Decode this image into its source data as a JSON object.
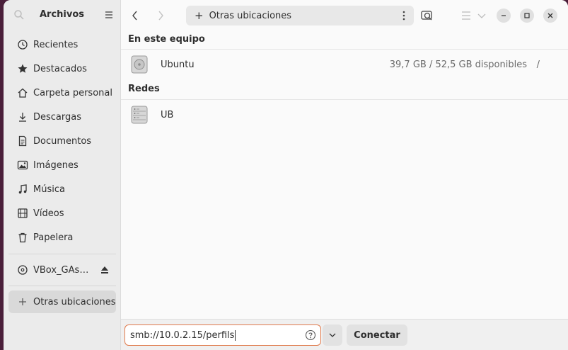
{
  "sidebar": {
    "title": "Archivos",
    "items": [
      {
        "label": "Recientes",
        "icon": "clock-icon"
      },
      {
        "label": "Destacados",
        "icon": "star-icon"
      },
      {
        "label": "Carpeta personal",
        "icon": "home-icon"
      },
      {
        "label": "Descargas",
        "icon": "download-icon"
      },
      {
        "label": "Documentos",
        "icon": "document-icon"
      },
      {
        "label": "Imágenes",
        "icon": "image-icon"
      },
      {
        "label": "Música",
        "icon": "music-icon"
      },
      {
        "label": "Vídeos",
        "icon": "video-icon"
      },
      {
        "label": "Papelera",
        "icon": "trash-icon"
      }
    ],
    "devices": [
      {
        "label": "VBox_GAs_...",
        "icon": "disc-icon"
      }
    ],
    "other_locations": {
      "label": "Otras ubicaciones",
      "icon": "plus-icon"
    }
  },
  "header": {
    "path": "Otras ubicaciones"
  },
  "sections": {
    "this_computer": {
      "title": "En este equipo",
      "rows": [
        {
          "name": "Ubuntu",
          "info": "39,7 GB / 52,5 GB disponibles",
          "mount": "/"
        }
      ]
    },
    "networks": {
      "title": "Redes",
      "rows": [
        {
          "name": "UB"
        }
      ]
    }
  },
  "bottom": {
    "address_value": "smb://10.0.2.15/perfils",
    "connect_label": "Conectar"
  },
  "colors": {
    "accent_focus": "#e07a4c",
    "sidebar_bg": "#ebebeb",
    "content_bg": "#fafafa"
  }
}
